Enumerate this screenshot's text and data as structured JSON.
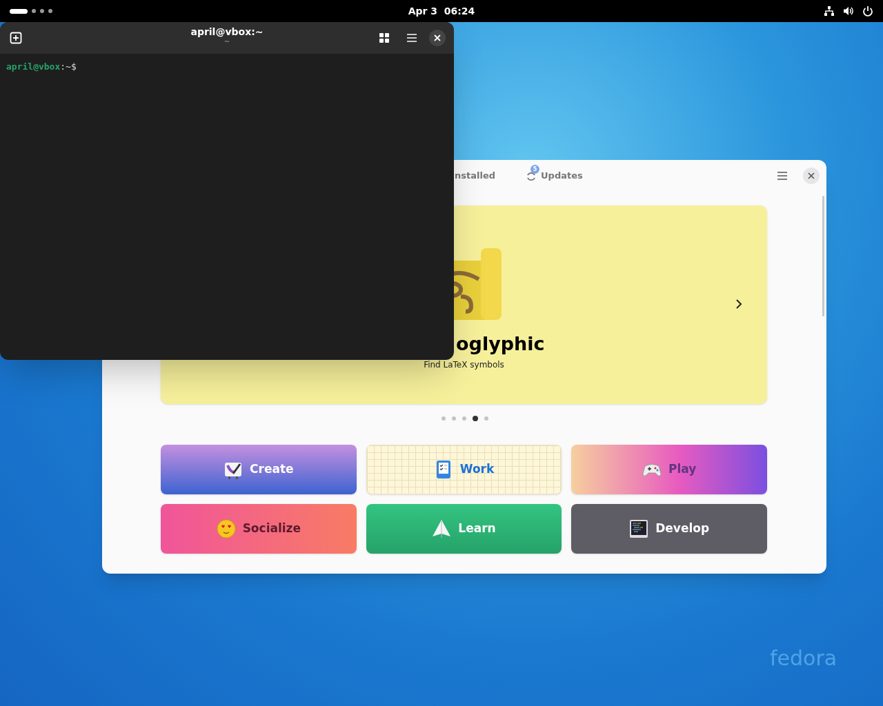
{
  "top_bar": {
    "workspaces": [
      {
        "selected": true
      },
      {
        "selected": false
      },
      {
        "selected": false
      },
      {
        "selected": false
      }
    ],
    "clock": "Apr 3  06:24"
  },
  "terminal": {
    "title": "april@vbox:~",
    "subtitle": "~",
    "prompt": {
      "user_host": "april@vbox",
      "path": ":~$"
    }
  },
  "software": {
    "tabs": [
      {
        "label": "nstalled",
        "selected": false
      },
      {
        "label": "Updates",
        "selected": false,
        "badge": "5"
      }
    ],
    "banner": {
      "title": "oglyphic",
      "subtitle": "Find LaTeX symbols",
      "pages": [
        {
          "selected": false
        },
        {
          "selected": false
        },
        {
          "selected": false
        },
        {
          "selected": true
        },
        {
          "selected": false
        }
      ]
    },
    "categories": [
      {
        "label": "Create",
        "kind": "create"
      },
      {
        "label": "Work",
        "kind": "work"
      },
      {
        "label": "Play",
        "kind": "play"
      },
      {
        "label": "Socialize",
        "kind": "socialize"
      },
      {
        "label": "Learn",
        "kind": "learn"
      },
      {
        "label": "Develop",
        "kind": "develop"
      }
    ]
  },
  "desktop": {
    "logo": "fedora"
  }
}
